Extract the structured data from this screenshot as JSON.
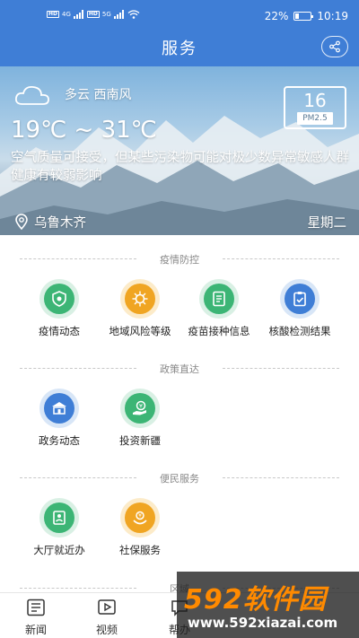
{
  "status_bar": {
    "carrier_marks": [
      "HD",
      "HD"
    ],
    "signal_labels": [
      "4G",
      "5G"
    ],
    "battery": "22%",
    "battery_level": 0.22,
    "time": "10:19"
  },
  "header": {
    "title": "服务",
    "share_icon": "share-icon"
  },
  "weather": {
    "condition": "多云 西南风",
    "temperature": "19℃ ~ 31℃",
    "air_quality": "空气质量可接受，但某些污染物可能对极少数异常敏感人群健康有较弱影响",
    "pm_value": "16",
    "pm_label": "PM2.5",
    "location": "乌鲁木齐",
    "weekday": "星期二"
  },
  "sections": [
    {
      "title": "疫情防控",
      "items": [
        {
          "label": "疫情动态",
          "icon": "shield-virus-icon",
          "color": "#3cb575"
        },
        {
          "label": "地域风险等级",
          "icon": "virus-icon",
          "color": "#f0a522"
        },
        {
          "label": "疫苗接种信息",
          "icon": "list-doc-icon",
          "color": "#3cb575"
        },
        {
          "label": "核酸检测结果",
          "icon": "clipboard-check-icon",
          "color": "#3f7ed6"
        }
      ]
    },
    {
      "title": "政策直达",
      "items": [
        {
          "label": "政务动态",
          "icon": "government-icon",
          "color": "#3f7ed6"
        },
        {
          "label": "投资新疆",
          "icon": "money-hand-icon",
          "color": "#3cb575"
        }
      ]
    },
    {
      "title": "便民服务",
      "items": [
        {
          "label": "大厅就近办",
          "icon": "hall-doc-icon",
          "color": "#3cb575"
        },
        {
          "label": "社保服务",
          "icon": "social-security-icon",
          "color": "#f0a522"
        }
      ]
    },
    {
      "title": "区域"
    }
  ],
  "bottom_nav": [
    {
      "label": "新闻",
      "icon": "news-icon"
    },
    {
      "label": "视频",
      "icon": "video-icon"
    },
    {
      "label": "帮办",
      "icon": "help-icon"
    }
  ],
  "watermark": {
    "main": "592软件园",
    "sub": "www.592xiazai.com"
  }
}
